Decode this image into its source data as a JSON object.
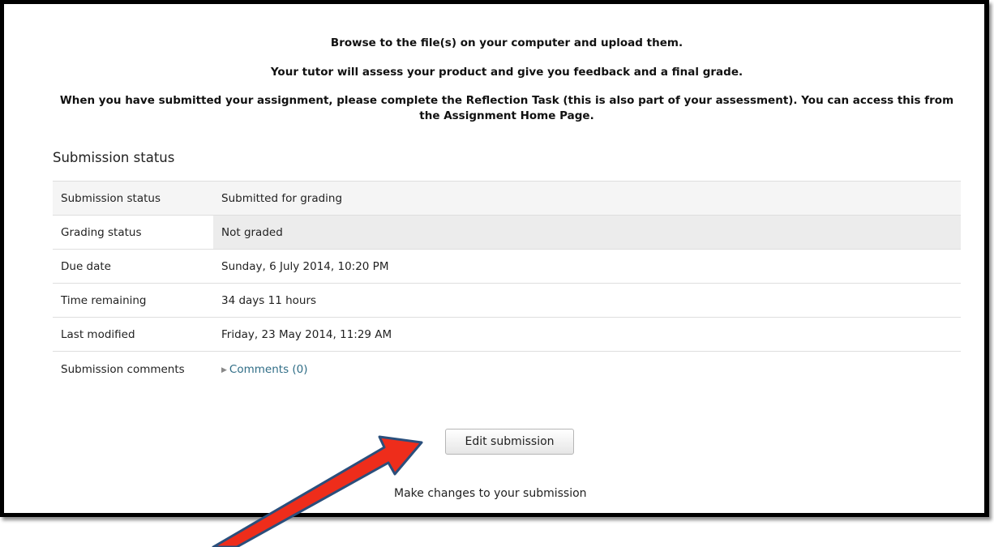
{
  "instructions": [
    "Browse to the file(s) on your computer and upload them.",
    "Your tutor will assess your product and give you feedback and a final grade.",
    "When you have submitted your assignment, please complete the Reflection Task (this is also part of your assessment). You can access this from the Assignment Home Page."
  ],
  "section_title": "Submission status",
  "rows": [
    {
      "label": "Submission status",
      "value": "Submitted for grading"
    },
    {
      "label": "Grading status",
      "value": "Not graded"
    },
    {
      "label": "Due date",
      "value": "Sunday, 6 July 2014, 10:20 PM"
    },
    {
      "label": "Time remaining",
      "value": "34 days 11 hours"
    },
    {
      "label": "Last modified",
      "value": "Friday, 23 May 2014, 11:29 AM"
    },
    {
      "label": "Submission comments",
      "value": "Comments (0)"
    }
  ],
  "edit_button": "Edit submission",
  "edit_hint": "Make changes to your submission",
  "colors": {
    "arrow_fill": "#ee2d1b",
    "arrow_stroke": "#2a4f7c",
    "link": "#2f6d86"
  }
}
